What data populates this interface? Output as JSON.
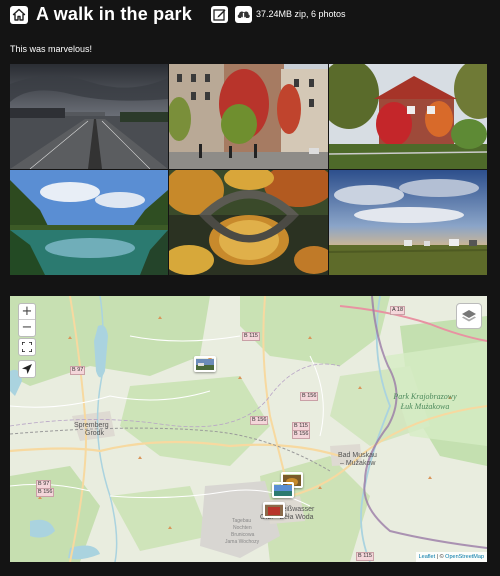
{
  "header": {
    "title": "A walk in the park",
    "zip_info": "37.24MB zip, 6 photos",
    "home_icon": "home-icon",
    "edit_icon": "edit-icon",
    "download_icon": "cloud-download-icon"
  },
  "description": "This was marvelous!",
  "gallery": {
    "photos": [
      {
        "subject": "highway-under-stormy-sky"
      },
      {
        "subject": "ivy-covered-buildings-street"
      },
      {
        "subject": "red-ivy-house-autumn"
      },
      {
        "subject": "lake-forest-reflection"
      },
      {
        "subject": "stone-bridge-autumn-reflection"
      },
      {
        "subject": "countryside-cloudy-sunset"
      }
    ]
  },
  "map": {
    "zoom_in": "+",
    "zoom_out": "−",
    "labels": {
      "spremberg": "Spremberg",
      "grodk": "Grodk",
      "bad_muskau": "Bad Muskau",
      "muzakow": "– Mužakow",
      "weisswasser": "Weißwasser",
      "weisswasser2": "O.L. - Běła Woda",
      "tagebau1": "Tagebau",
      "tagebau2": "Nochten",
      "tagebau3": "Brunicowa",
      "tagebau4": "Jama Wochozy",
      "park1": "Park Krajobrazowy",
      "park2": "Łuk Mużakowa"
    },
    "roads": [
      "B 115",
      "B 97",
      "B 156",
      "B 156",
      "B 115",
      "B 156",
      "A 18",
      "B 97",
      "B 156",
      "B 115"
    ],
    "attribution": {
      "leaflet": "Leaflet",
      "sep": " | © ",
      "osm": "OpenStreetMap"
    }
  }
}
